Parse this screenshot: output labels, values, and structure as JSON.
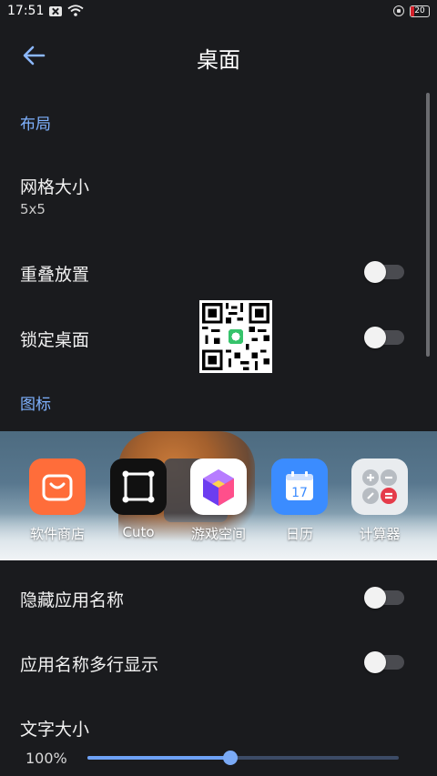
{
  "status_bar": {
    "time": "17:51",
    "battery_level": "20"
  },
  "header": {
    "title": "桌面"
  },
  "sections": {
    "layout": "布局",
    "icons": "图标"
  },
  "settings": {
    "grid_size": {
      "label": "网格大小",
      "value": "5x5"
    },
    "overlap": {
      "label": "重叠放置",
      "enabled": false
    },
    "lock_desktop": {
      "label": "锁定桌面",
      "enabled": false
    },
    "hide_app_names": {
      "label": "隐藏应用名称",
      "enabled": false
    },
    "multiline_names": {
      "label": "应用名称多行显示",
      "enabled": false
    },
    "text_size": {
      "label": "文字大小",
      "value": "100%",
      "slider_fraction": 0.46
    }
  },
  "preview_apps": [
    {
      "label": "软件商店",
      "icon": "shopping-bag-icon",
      "color": "#ff6d3a"
    },
    {
      "label": "Cuto",
      "icon": "crop-frame-icon",
      "color": "#111111"
    },
    {
      "label": "游戏空间",
      "icon": "cube-icon",
      "color": "#ffffff"
    },
    {
      "label": "日历",
      "icon": "calendar-icon",
      "color": "#3b8cff"
    },
    {
      "label": "计算器",
      "icon": "calculator-icon",
      "color": "#e9ecef"
    }
  ],
  "calendar_day": "17",
  "colors": {
    "accent": "#7fb2ff",
    "background": "#1a1b1e"
  }
}
